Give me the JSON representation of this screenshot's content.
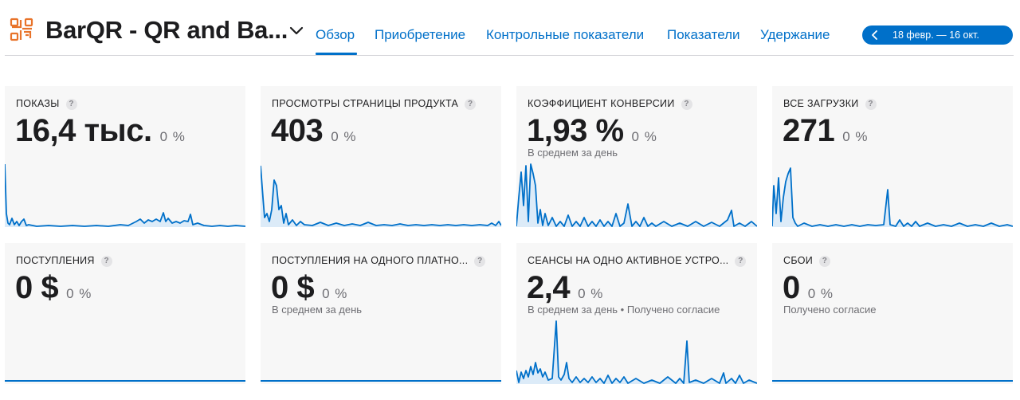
{
  "header": {
    "app_title": "BarQR - QR and Ba...",
    "tabs": [
      {
        "label": "Обзор",
        "active": true
      },
      {
        "label": "Приобретение",
        "active": false
      },
      {
        "label": "Контрольные показатели",
        "active": false
      },
      {
        "label": "Показатели",
        "active": false
      },
      {
        "label": "Удержание",
        "active": false
      }
    ],
    "date_range": "18 февр. — 16 окт."
  },
  "colors": {
    "accent": "#0070c9",
    "app_icon": "#e8732a",
    "card_bg": "#f7f7f7"
  },
  "icons": {
    "app": "barqr-app-icon",
    "title_menu": "chevron-down-icon",
    "date_prev": "chevron-left-icon",
    "help": "question-mark-icon"
  },
  "metrics": [
    {
      "label": "ПОКАЗЫ",
      "help": "?",
      "value": "16,4 тыс.",
      "change": "0 %",
      "sub": ""
    },
    {
      "label": "ПРОСМОТРЫ СТРАНИЦЫ ПРОДУКТА",
      "help": "?",
      "value": "403",
      "change": "0 %",
      "sub": ""
    },
    {
      "label": "КОЭФФИЦИЕНТ КОНВЕРСИИ",
      "help": "?",
      "value": "1,93 %",
      "change": "0 %",
      "sub": "В среднем за день"
    },
    {
      "label": "ВСЕ ЗАГРУЗКИ",
      "help": "?",
      "value": "271",
      "change": "0 %",
      "sub": ""
    },
    {
      "label": "ПОСТУПЛЕНИЯ",
      "help": "?",
      "value": "0 $",
      "change": "0 %",
      "sub": ""
    },
    {
      "label": "ПОСТУПЛЕНИЯ НА ОДНОГО ПЛАТНО...",
      "help": "?",
      "value": "0 $",
      "change": "0 %",
      "sub": "В среднем за день"
    },
    {
      "label": "СЕАНСЫ НА ОДНО АКТИВНОЕ УСТРО...",
      "help": "?",
      "value": "2,4",
      "change": "0 %",
      "sub": "В среднем за день • Получено согласие"
    },
    {
      "label": "СБОИ",
      "help": "?",
      "value": "0",
      "change": "0 %",
      "sub": "Получено согласие"
    }
  ]
}
